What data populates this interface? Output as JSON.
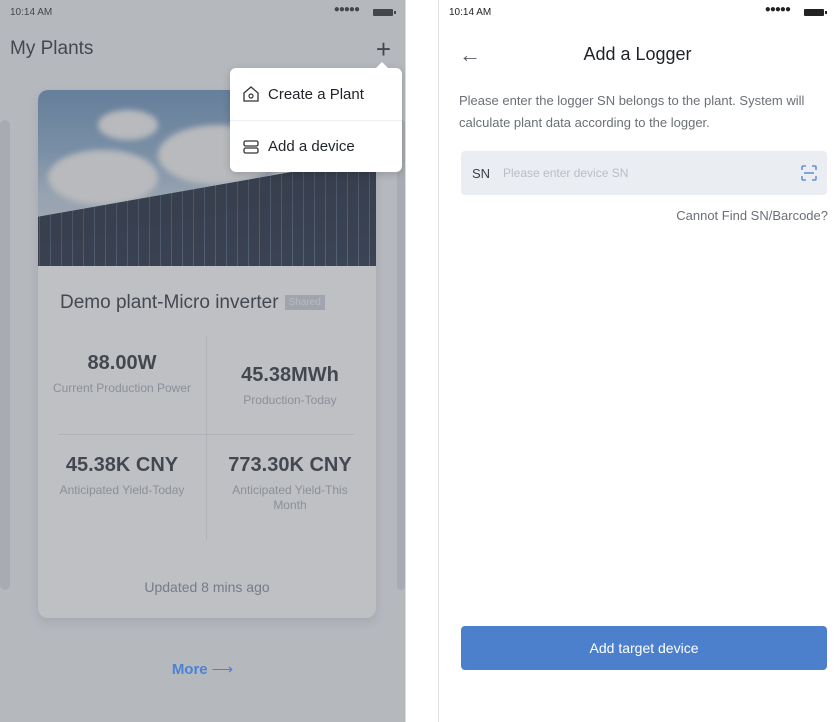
{
  "left_screen": {
    "status_bar": {
      "time": "10:14 AM",
      "signal": "●●●●●"
    },
    "header": {
      "title": "My Plants",
      "add_icon": "plus-icon"
    },
    "menu": {
      "items": [
        {
          "label": "Create a Plant",
          "icon": "plant-house-icon"
        },
        {
          "label": "Add a device",
          "icon": "device-icon"
        }
      ]
    },
    "card": {
      "name": "Demo plant-Micro inverter",
      "badge": "Shared",
      "stats": [
        {
          "value": "88.00W",
          "label": "Current Production Power"
        },
        {
          "value": "45.38MWh",
          "label": "Production-Today"
        },
        {
          "value": "45.38K CNY",
          "label": "Anticipated Yield-Today"
        },
        {
          "value": "773.30K CNY",
          "label": "Anticipated Yield-This Month"
        }
      ],
      "updated": "Updated 8 mins ago"
    },
    "more": {
      "label": "More",
      "arrow": "⟶"
    }
  },
  "right_screen": {
    "status_bar": {
      "time": "10:14 AM",
      "signal": "●●●●●"
    },
    "header": {
      "title": "Add a Logger",
      "back_icon": "arrow-left-icon"
    },
    "description": "Please enter the logger SN belongs to the plant. System will calculate plant data according to the logger.",
    "sn_field": {
      "label": "SN",
      "placeholder": "Please enter device SN",
      "value": "",
      "scan_icon": "scan-icon"
    },
    "help_link": "Cannot Find SN/Barcode?",
    "submit_button": "Add target device",
    "colors": {
      "accent": "#4c80cc",
      "field_bg": "#eaedf2"
    }
  }
}
